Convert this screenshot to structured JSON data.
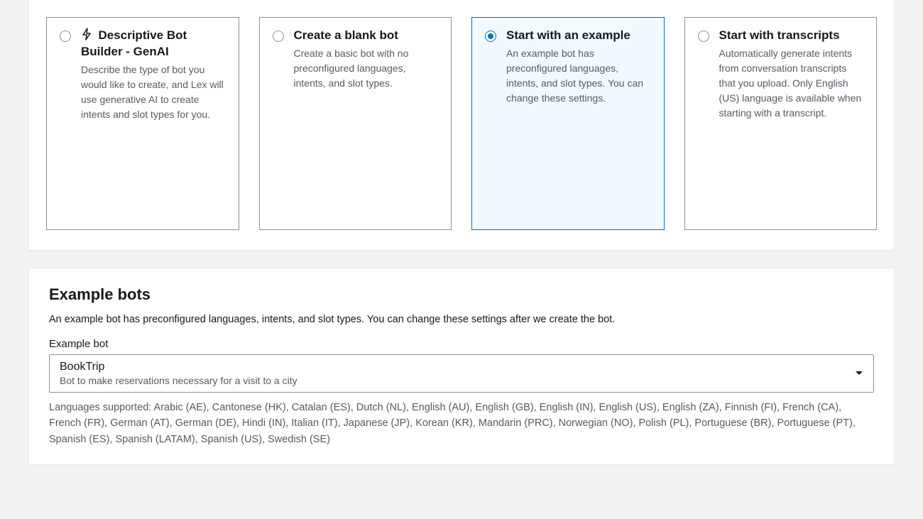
{
  "creation_options": [
    {
      "id": "genai",
      "has_bolt_icon": true,
      "title": "Descriptive Bot Builder - GenAI",
      "description": "Describe the type of bot you would like to create, and Lex will use generative AI to create intents and slot types for you.",
      "selected": false
    },
    {
      "id": "blank",
      "has_bolt_icon": false,
      "title": "Create a blank bot",
      "description": "Create a basic bot with no preconfigured languages, intents, and slot types.",
      "selected": false
    },
    {
      "id": "example",
      "has_bolt_icon": false,
      "title": "Start with an example",
      "description": "An example bot has preconfigured languages, intents, and slot types. You can change these settings.",
      "selected": true
    },
    {
      "id": "transcripts",
      "has_bolt_icon": false,
      "title": "Start with transcripts",
      "description": "Automatically generate intents from conversation transcripts that you upload. Only English (US) language is available when starting with a transcript.",
      "selected": false
    }
  ],
  "example_section": {
    "heading": "Example bots",
    "subtext": "An example bot has preconfigured languages, intents, and slot types. You can change these settings after we create the bot.",
    "field_label": "Example bot",
    "select": {
      "value": "BookTrip",
      "description": "Bot to make reservations necessary for a visit to a city"
    },
    "languages_text": "Languages supported: Arabic (AE), Cantonese (HK), Catalan (ES), Dutch (NL), English (AU), English (GB), English (IN), English (US), English (ZA), Finnish (FI), French (CA), French (FR), German (AT), German (DE), Hindi (IN), Italian (IT), Japanese (JP), Korean (KR), Mandarin (PRC), Norwegian (NO), Polish (PL), Portuguese (BR), Portuguese (PT), Spanish (ES), Spanish (LATAM), Spanish (US), Swedish (SE)"
  }
}
